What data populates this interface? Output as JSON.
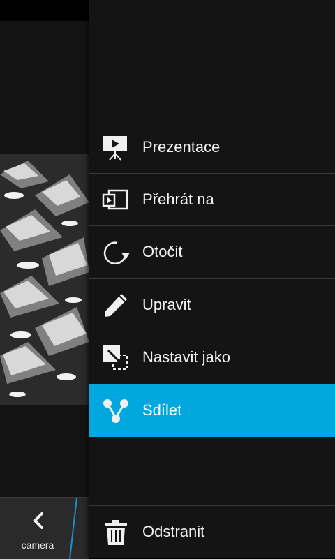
{
  "bottom_bar": {
    "back_label": "camera"
  },
  "menu": {
    "items": [
      {
        "label": "Prezentace",
        "icon": "slideshow-icon"
      },
      {
        "label": "Přehrát na",
        "icon": "play-on-device-icon"
      },
      {
        "label": "Otočit",
        "icon": "rotate-icon"
      },
      {
        "label": "Upravit",
        "icon": "pencil-icon"
      },
      {
        "label": "Nastavit jako",
        "icon": "set-as-icon"
      },
      {
        "label": "Sdílet",
        "icon": "share-icon",
        "active": true
      }
    ],
    "delete_label": "Odstranit"
  },
  "colors": {
    "accent": "#00a8df",
    "background": "#141414",
    "separator": "#3a3a3a"
  }
}
